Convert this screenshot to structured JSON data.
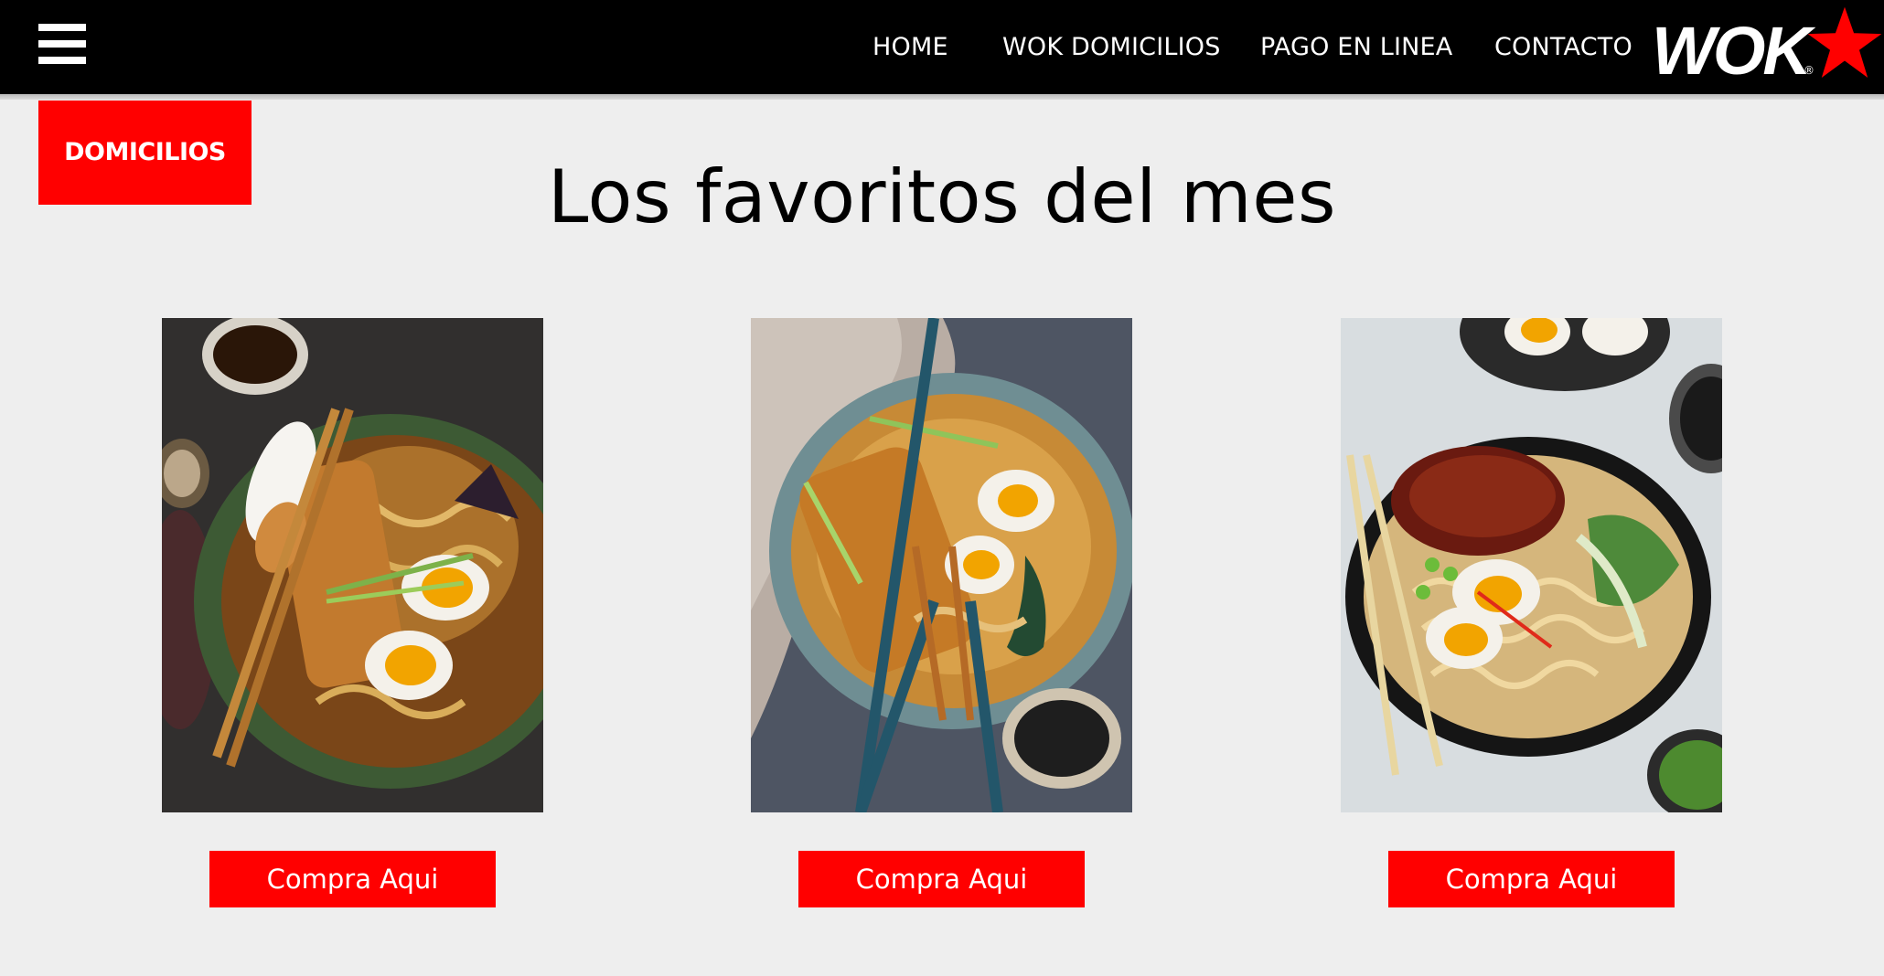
{
  "header": {
    "menu_icon": "hamburger-menu-icon",
    "nav": [
      "HOME",
      "WOK DOMICILIOS",
      "PAGO EN LINEA",
      "CONTACTO"
    ],
    "logo_text": "WOK",
    "logo_mark": "®",
    "logo_icon": "red-star-icon"
  },
  "domicilios_button": "DOMICILIOS",
  "main": {
    "title": "Los favoritos del mes",
    "products": [
      {
        "image": "ramen-bowl-photo-1",
        "button": "Compra Aqui"
      },
      {
        "image": "ramen-bowl-photo-2",
        "button": "Compra Aqui"
      },
      {
        "image": "ramen-bowl-photo-3",
        "button": "Compra Aqui"
      }
    ]
  },
  "colors": {
    "accent": "#ff0000",
    "header_bg": "#000000",
    "page_bg": "#eeeeee"
  }
}
